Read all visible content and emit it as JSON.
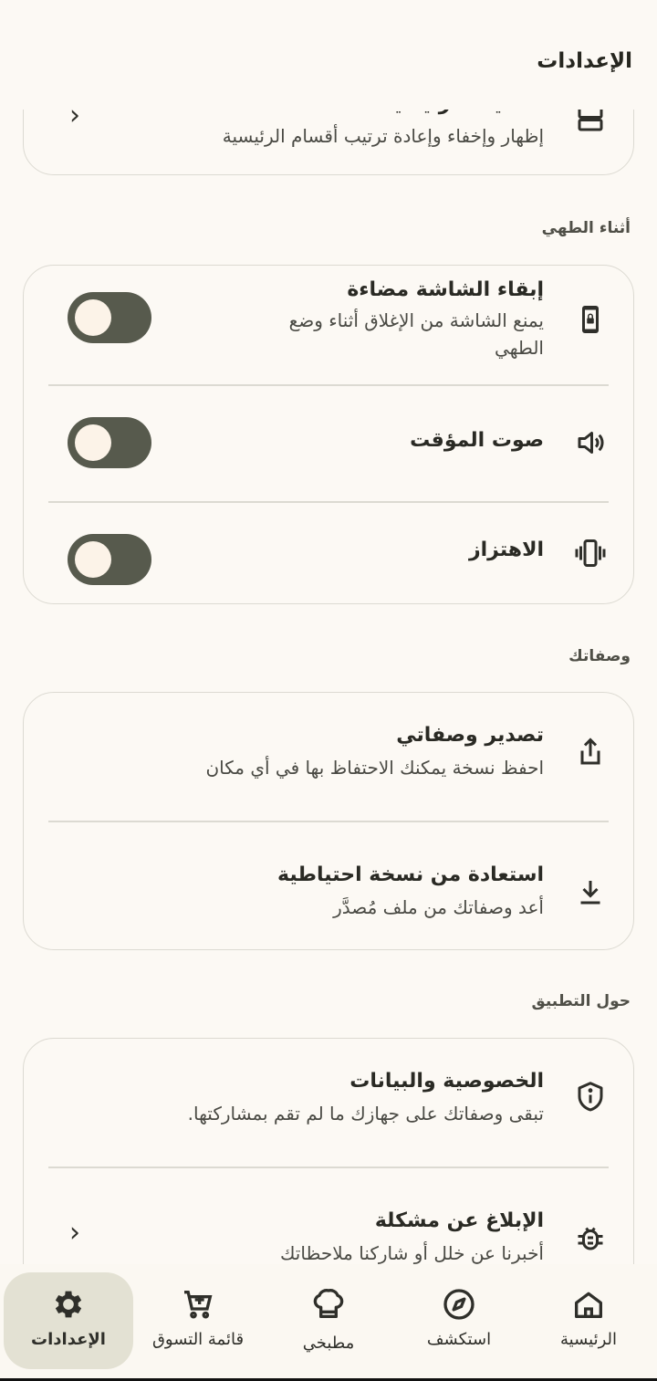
{
  "app_bar": {
    "title": "الإعدادات"
  },
  "top_partial": {
    "title": "تخطيط الرئيسية",
    "subtitle": "إظهار وإخفاء وإعادة ترتيب أقسام الرئيسية",
    "icon": "layout-rows-icon"
  },
  "cooking": {
    "section_title": "أثناء الطهي",
    "items": [
      {
        "title": "إبقاء الشاشة مضاءة",
        "subtitle_line1": "يمنع الشاشة من الإغلاق أثناء وضع",
        "subtitle_line2": "الطهي",
        "icon": "phone-lock-icon",
        "toggle_on": false
      },
      {
        "title": "صوت المؤقت",
        "icon": "volume-icon",
        "toggle_on": false
      },
      {
        "title": "الاهتزاز",
        "icon": "vibration-icon",
        "toggle_on": false
      }
    ]
  },
  "recipes": {
    "section_title": "وصفاتك",
    "items": [
      {
        "title": "تصدير وصفاتي",
        "subtitle": "احفظ نسخة يمكنك الاحتفاظ بها في أي مكان",
        "icon": "share-upload-icon"
      },
      {
        "title": "استعادة من نسخة احتياطية",
        "subtitle": "أعد وصفاتك من ملف مُصدَّر",
        "icon": "download-icon"
      }
    ]
  },
  "about": {
    "section_title": "حول التطبيق",
    "items": [
      {
        "title": "الخصوصية والبيانات",
        "subtitle": "تبقى وصفاتك على جهازك ما لم تقم بمشاركتها.",
        "icon": "shield-info-icon"
      },
      {
        "title": "الإبلاغ عن مشكلة",
        "subtitle": "أخبرنا عن خلل أو شاركنا ملاحظاتك",
        "icon": "bug-icon"
      }
    ]
  },
  "bottom_nav": {
    "items": [
      {
        "label": "الرئيسية",
        "icon": "home-icon"
      },
      {
        "label": "استكشف",
        "icon": "compass-icon"
      },
      {
        "label": "مطبخي",
        "icon": "chef-hat-icon"
      },
      {
        "label": "قائمة التسوق",
        "icon": "cart-icon"
      },
      {
        "label": "الإعدادات",
        "icon": "gear-icon",
        "active": true
      }
    ]
  },
  "colors": {
    "background": "#fcf9f4",
    "toggle_track": "#575a4d",
    "active_nav_bg": "#e3e1d3"
  }
}
